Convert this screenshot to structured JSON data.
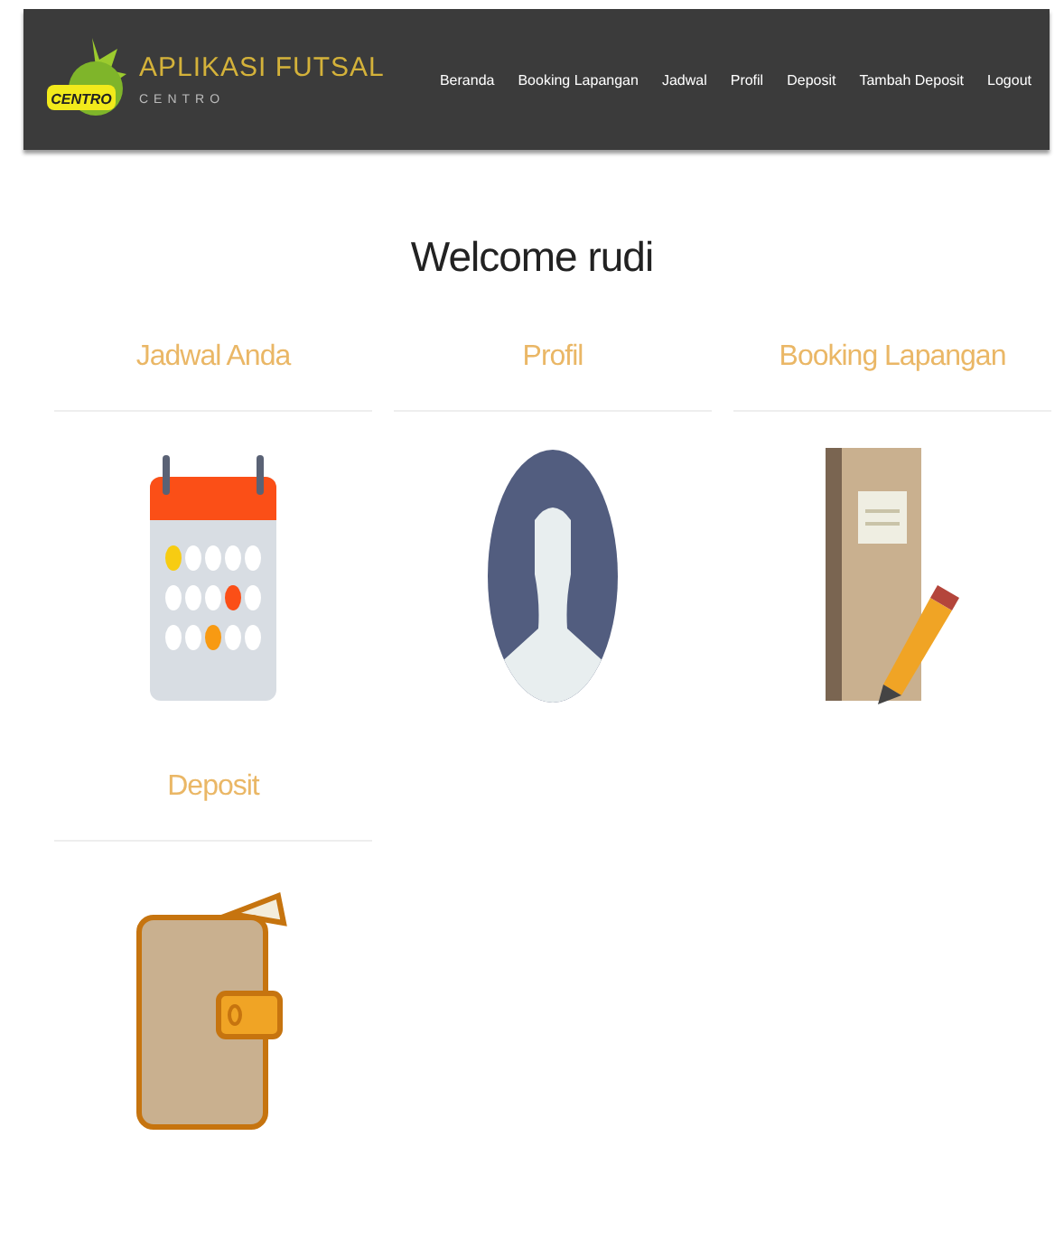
{
  "navbar": {
    "logo_badge": "CENTRO",
    "brand": "APLIKASI FUTSAL",
    "subtitle": "CENTRO",
    "links": [
      {
        "label": "Beranda"
      },
      {
        "label": "Booking Lapangan"
      },
      {
        "label": "Jadwal"
      },
      {
        "label": "Profil"
      },
      {
        "label": "Deposit"
      },
      {
        "label": "Tambah Deposit"
      },
      {
        "label": "Logout"
      }
    ]
  },
  "welcome": "Welcome rudi",
  "cards": [
    {
      "title": "Jadwal Anda",
      "kind": "calendar"
    },
    {
      "title": "Profil",
      "kind": "profile"
    },
    {
      "title": "Booking Lapangan",
      "kind": "book"
    },
    {
      "title": "Deposit",
      "kind": "wallet"
    }
  ]
}
